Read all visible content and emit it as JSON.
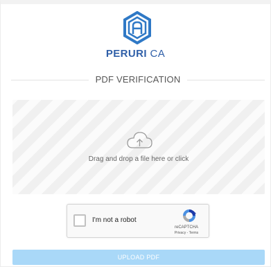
{
  "brand": {
    "name_main": "PERURI",
    "name_suffix": "CA",
    "logo_icon": "peruri-hexagon-logo-icon",
    "color": "#2f5fa8"
  },
  "section": {
    "title": "PDF VERIFICATION"
  },
  "dropzone": {
    "icon": "cloud-upload-icon",
    "text": "Drag and drop a file here or click"
  },
  "recaptcha": {
    "label": "I'm not a robot",
    "brand": "reCAPTCHA",
    "privacy": "Privacy",
    "separator": " - ",
    "terms": "Terms",
    "checked": false
  },
  "upload": {
    "label": "UPLOAD PDF",
    "color": "#a9d8f8"
  }
}
